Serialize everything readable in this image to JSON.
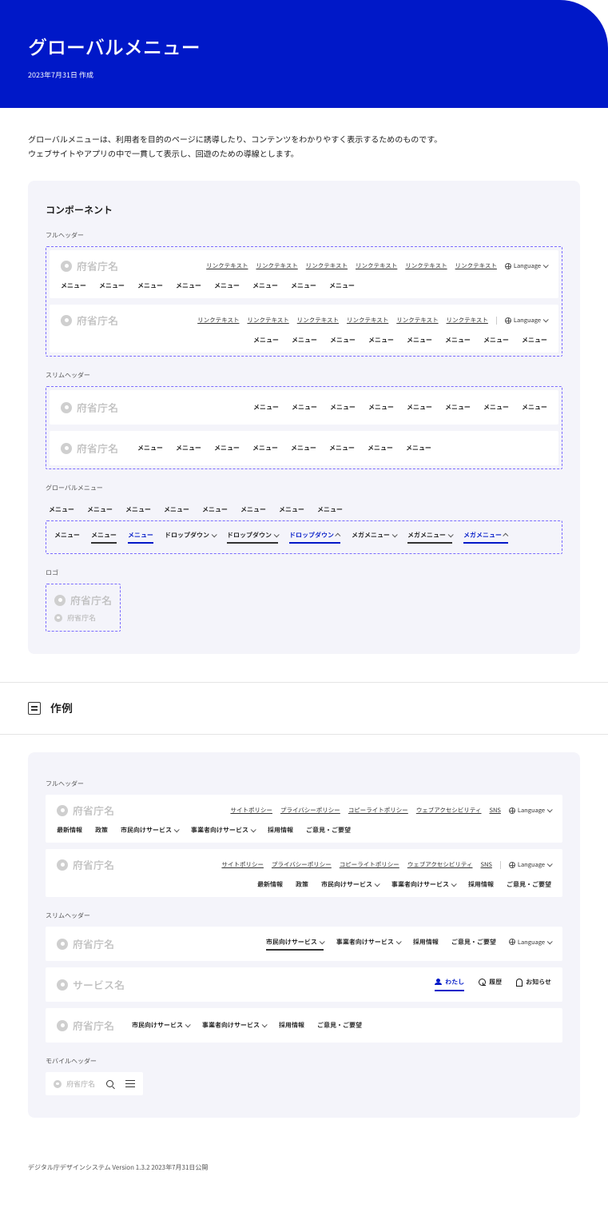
{
  "hero": {
    "title": "グローバルメニュー",
    "date": "2023年7月31日 作成"
  },
  "intro": {
    "line1": "グローバルメニューは、利用者を目的のページに誘導したり、コンテンツをわかりやすく表示するためのものです。",
    "line2": "ウェブサイトやアプリの中で一貫して表示し、回遊のための導線とします。"
  },
  "sections": {
    "components": "コンポーネント",
    "full_header": "フルヘッダー",
    "slim_header": "スリムヘッダー",
    "global_menu": "グローバルメニュー",
    "logo": "ロゴ",
    "examples": "作例",
    "mobile_header": "モバイルヘッダー"
  },
  "logo_name": "府省庁名",
  "service_name": "サービス名",
  "link_text": "リンクテキスト",
  "language": "Language",
  "menu_label": "メニュー",
  "dropdown_label": "ドロップダウン",
  "mega_label": "メガメニュー",
  "top_links": [
    "サイトポリシー",
    "プライバシーポリシー",
    "コピーライトポリシー",
    "ウェブアクセシビリティ",
    "SNS"
  ],
  "nav": {
    "latest": "最新情報",
    "policy": "政策",
    "citizen": "市民向けサービス",
    "business": "事業者向けサービス",
    "recruit": "採用情報",
    "feedback": "ご意見・ご要望"
  },
  "user_actions": {
    "me": "わたし",
    "history": "履歴",
    "notify": "お知らせ"
  },
  "footer": "デジタル庁デザインシステム Version 1.3.2  2023年7月31日公開"
}
